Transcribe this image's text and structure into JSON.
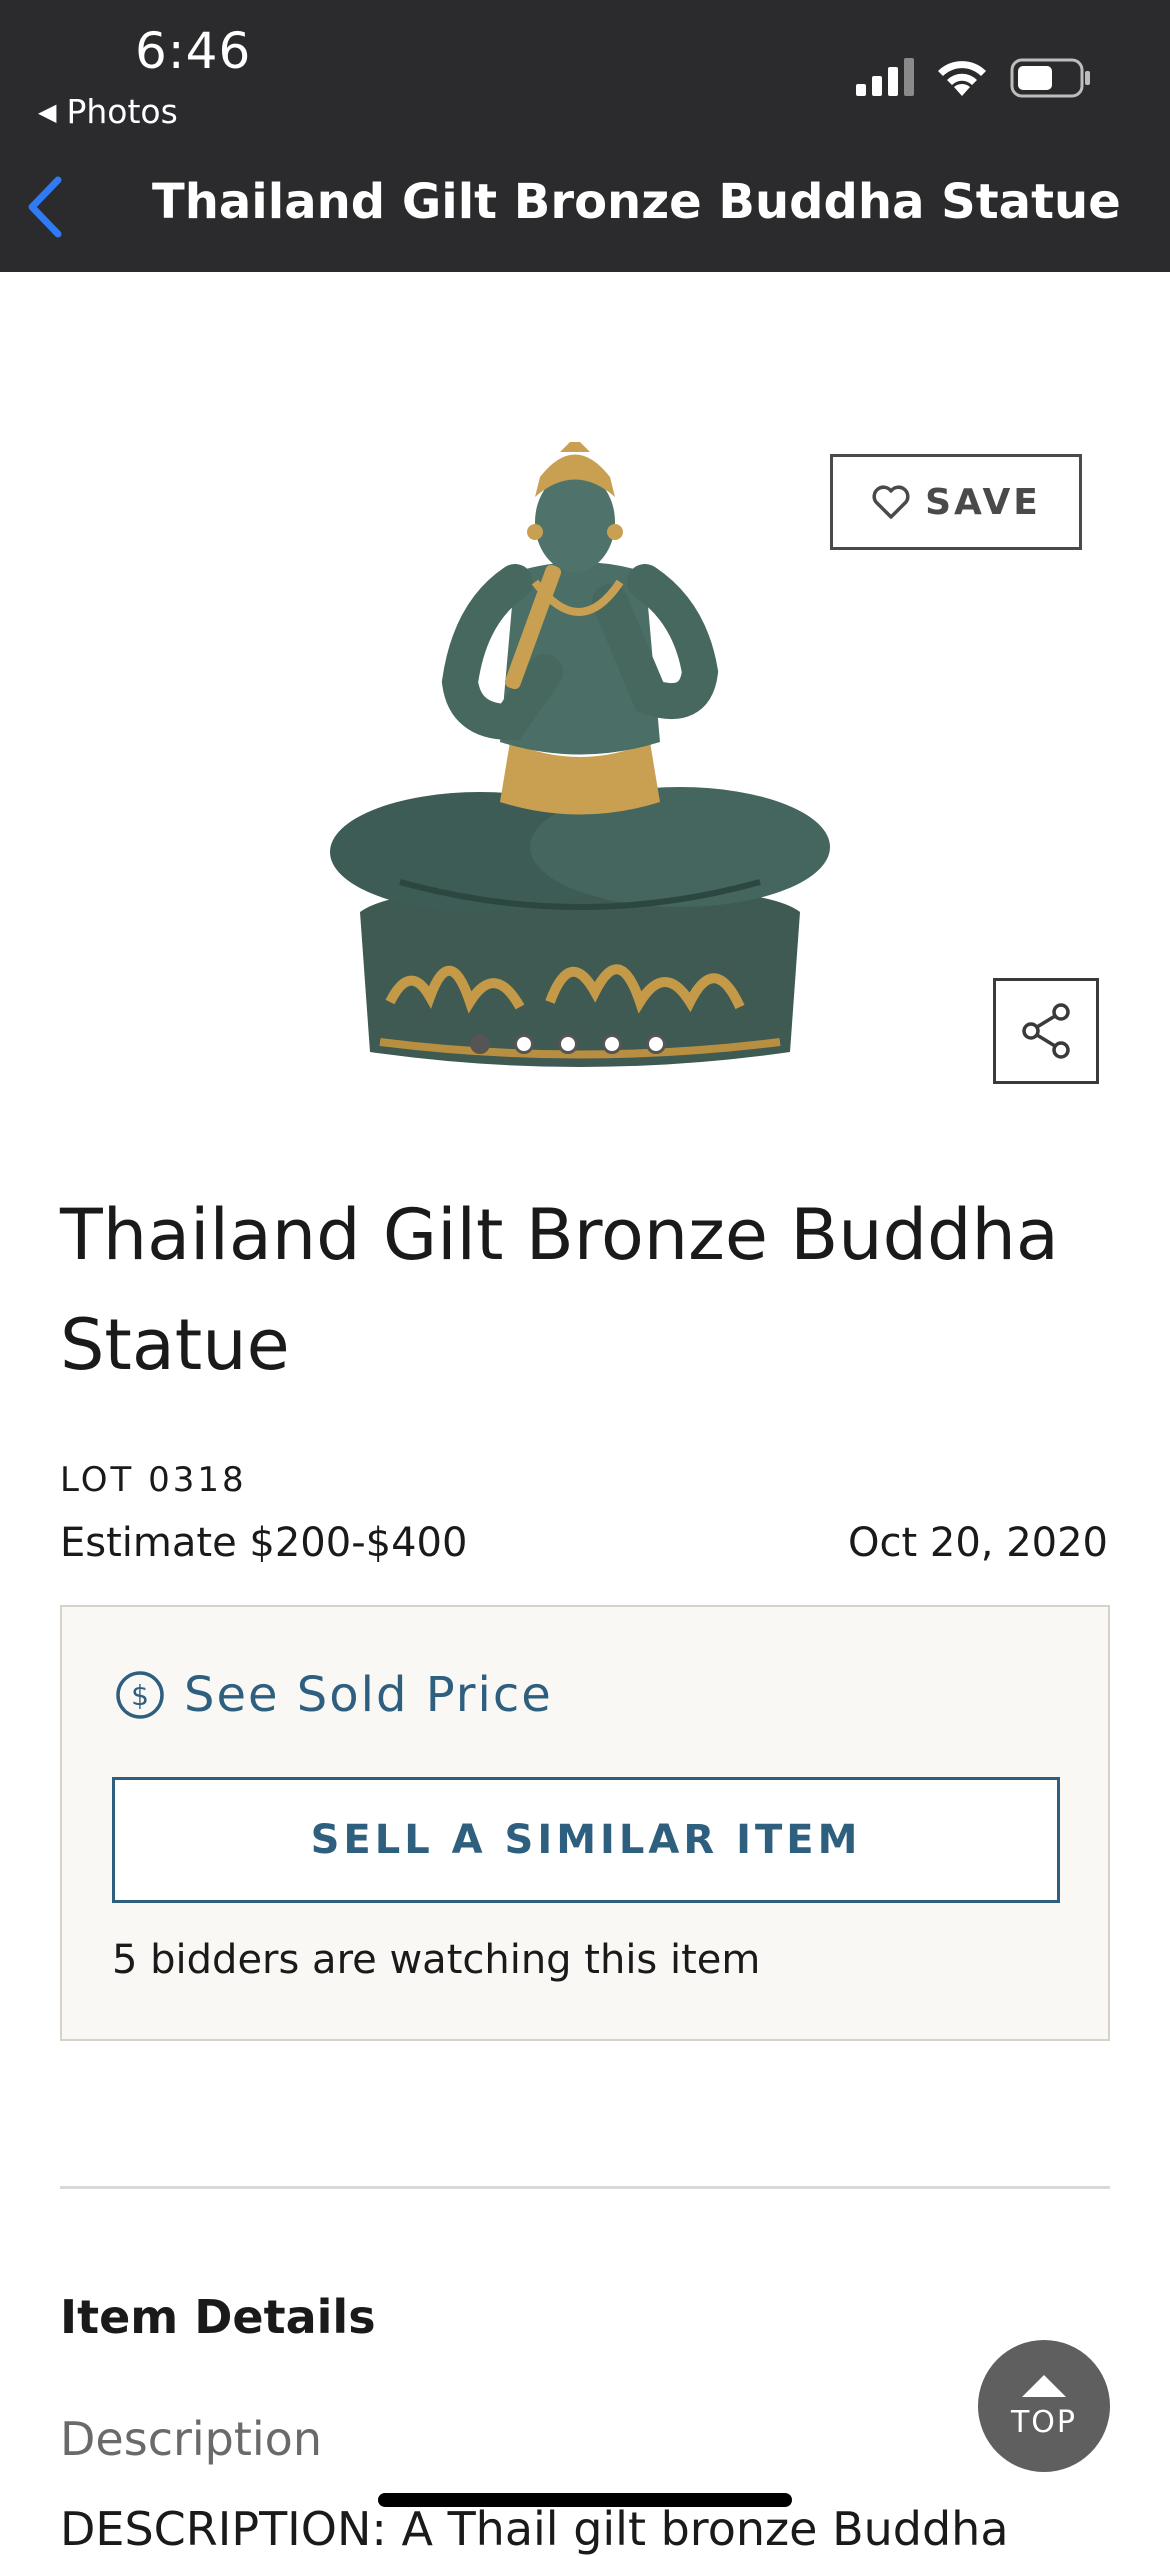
{
  "status_bar": {
    "time": "6:46",
    "back_app_label": "Photos"
  },
  "nav": {
    "title": "Thailand Gilt Bronze Buddha Statue - O..."
  },
  "gallery": {
    "save_label": "SAVE",
    "image_count": 5,
    "active_index": 0
  },
  "item": {
    "title": "Thailand Gilt Bronze Buddha Statue",
    "lot": "LOT 0318",
    "estimate": "Estimate $200-$400",
    "date": "Oct 20, 2020"
  },
  "actions": {
    "sold_price_label": "See Sold Price",
    "sell_similar_label": "SELL A SIMILAR ITEM",
    "watching_text": "5 bidders are watching this item"
  },
  "details": {
    "heading": "Item Details",
    "description_label": "Description",
    "description_text": "DESCRIPTION: A Thail gilt bronze Buddha"
  },
  "top_button": {
    "label": "TOP"
  },
  "colors": {
    "accent": "#2f5f7f",
    "header_bg": "#2b2b2d",
    "panel_bg": "#faf8f4"
  }
}
